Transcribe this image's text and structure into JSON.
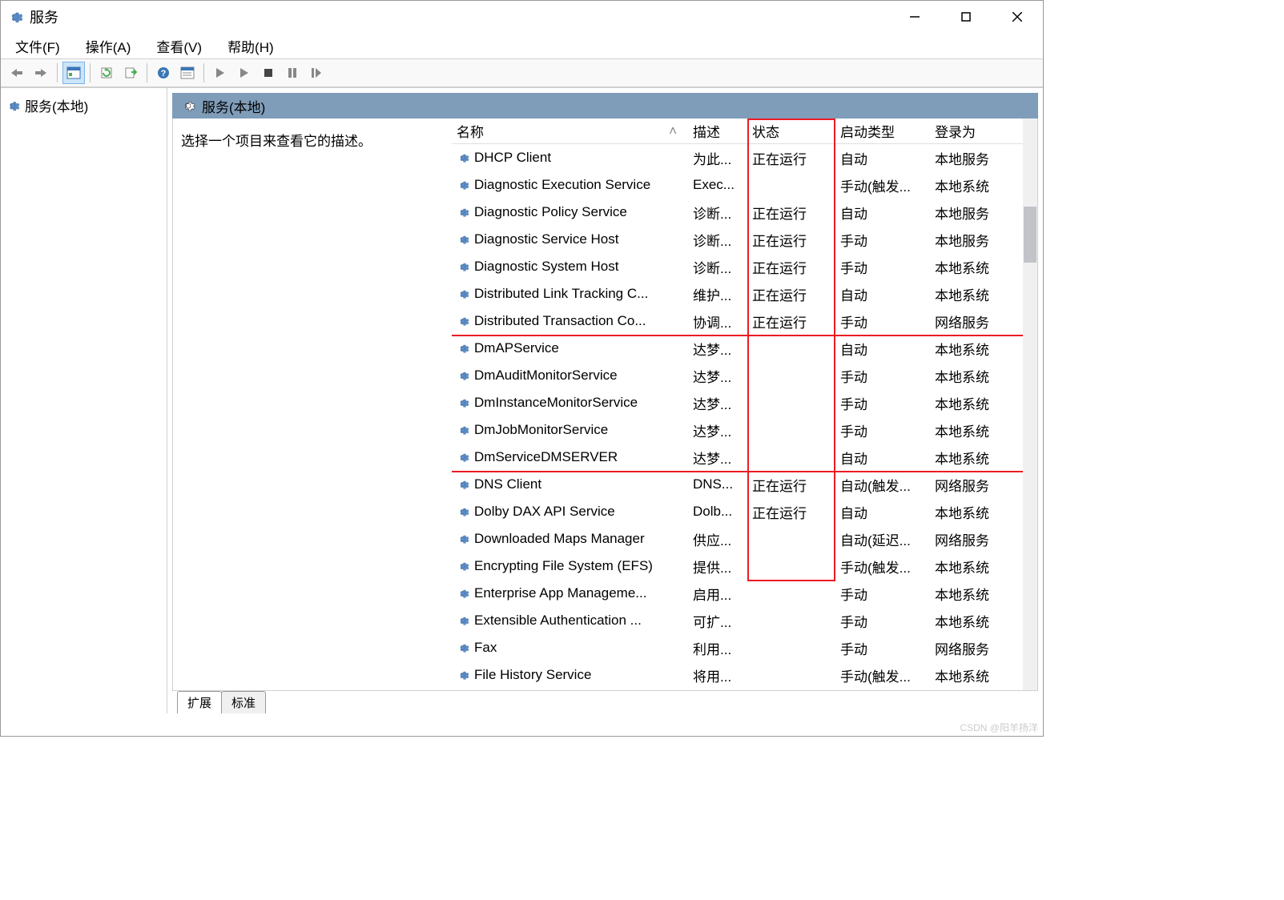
{
  "window": {
    "title": "服务"
  },
  "menu": {
    "file": "文件(F)",
    "action": "操作(A)",
    "view": "查看(V)",
    "help": "帮助(H)"
  },
  "tree": {
    "root": "服务(本地)"
  },
  "content": {
    "header": "服务(本地)",
    "desc_prompt": "选择一个项目来查看它的描述。"
  },
  "columns": {
    "name": "名称",
    "desc": "描述",
    "status": "状态",
    "start": "启动类型",
    "logon": "登录为"
  },
  "services": [
    {
      "name": "DHCP Client",
      "desc": "为此...",
      "status": "正在运行",
      "start": "自动",
      "logon": "本地服务"
    },
    {
      "name": "Diagnostic Execution Service",
      "desc": "Exec...",
      "status": "",
      "start": "手动(触发...",
      "logon": "本地系统"
    },
    {
      "name": "Diagnostic Policy Service",
      "desc": "诊断...",
      "status": "正在运行",
      "start": "自动",
      "logon": "本地服务"
    },
    {
      "name": "Diagnostic Service Host",
      "desc": "诊断...",
      "status": "正在运行",
      "start": "手动",
      "logon": "本地服务"
    },
    {
      "name": "Diagnostic System Host",
      "desc": "诊断...",
      "status": "正在运行",
      "start": "手动",
      "logon": "本地系统"
    },
    {
      "name": "Distributed Link Tracking C...",
      "desc": "维护...",
      "status": "正在运行",
      "start": "自动",
      "logon": "本地系统"
    },
    {
      "name": "Distributed Transaction Co...",
      "desc": "协调...",
      "status": "正在运行",
      "start": "手动",
      "logon": "网络服务"
    },
    {
      "name": "DmAPService",
      "desc": "达梦...",
      "status": "",
      "start": "自动",
      "logon": "本地系统"
    },
    {
      "name": "DmAuditMonitorService",
      "desc": "达梦...",
      "status": "",
      "start": "手动",
      "logon": "本地系统"
    },
    {
      "name": "DmInstanceMonitorService",
      "desc": "达梦...",
      "status": "",
      "start": "手动",
      "logon": "本地系统"
    },
    {
      "name": "DmJobMonitorService",
      "desc": "达梦...",
      "status": "",
      "start": "手动",
      "logon": "本地系统"
    },
    {
      "name": "DmServiceDMSERVER",
      "desc": "达梦...",
      "status": "",
      "start": "自动",
      "logon": "本地系统"
    },
    {
      "name": "DNS Client",
      "desc": "DNS...",
      "status": "正在运行",
      "start": "自动(触发...",
      "logon": "网络服务"
    },
    {
      "name": "Dolby DAX API Service",
      "desc": "Dolb...",
      "status": "正在运行",
      "start": "自动",
      "logon": "本地系统"
    },
    {
      "name": "Downloaded Maps Manager",
      "desc": "供应...",
      "status": "",
      "start": "自动(延迟...",
      "logon": "网络服务"
    },
    {
      "name": "Encrypting File System (EFS)",
      "desc": "提供...",
      "status": "",
      "start": "手动(触发...",
      "logon": "本地系统"
    },
    {
      "name": "Enterprise App Manageme...",
      "desc": "启用...",
      "status": "",
      "start": "手动",
      "logon": "本地系统"
    },
    {
      "name": "Extensible Authentication ...",
      "desc": "可扩...",
      "status": "",
      "start": "手动",
      "logon": "本地系统"
    },
    {
      "name": "Fax",
      "desc": "利用...",
      "status": "",
      "start": "手动",
      "logon": "网络服务"
    },
    {
      "name": "File History Service",
      "desc": "将用...",
      "status": "",
      "start": "手动(触发...",
      "logon": "本地系统"
    }
  ],
  "tabs": {
    "extended": "扩展",
    "standard": "标准"
  },
  "watermark": "CSDN @阳羊扬洋"
}
